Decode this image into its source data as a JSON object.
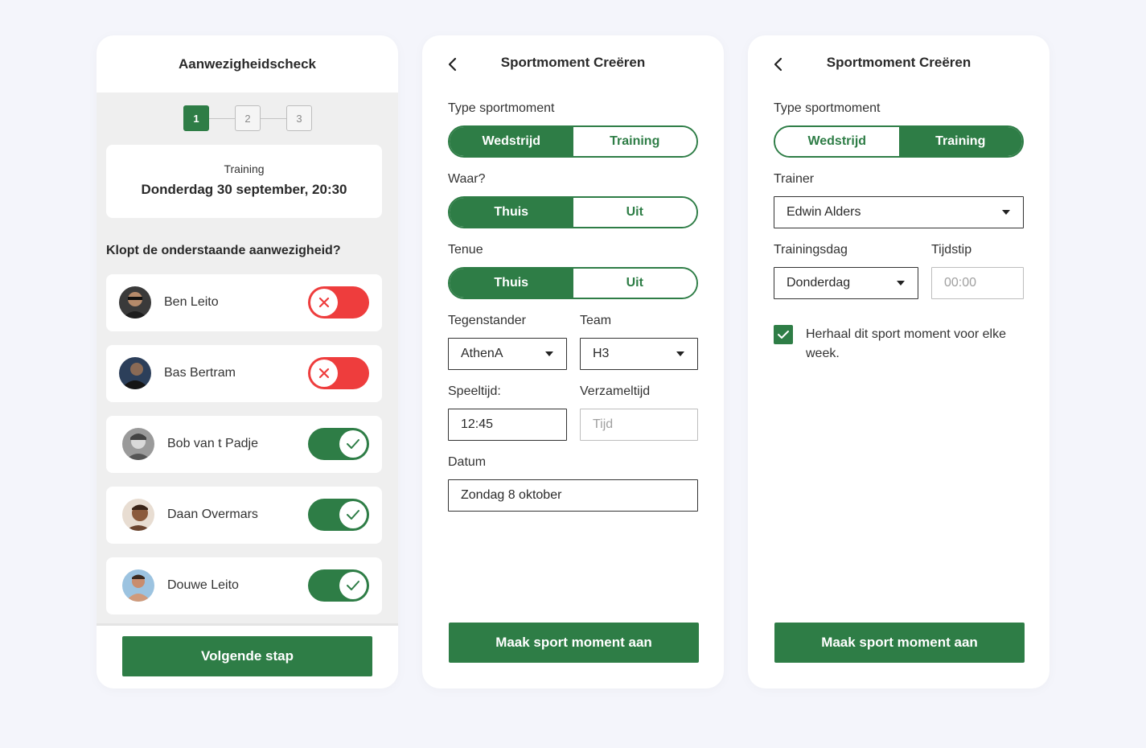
{
  "colors": {
    "accent": "#2e7d46",
    "danger": "#ee3d3d",
    "background": "#f4f5fb"
  },
  "attendance": {
    "title": "Aanwezigheidscheck",
    "steps": [
      "1",
      "2",
      "3"
    ],
    "active_step": 1,
    "session_type": "Training",
    "session_date": "Donderdag 30 september, 20:30",
    "question": "Klopt de onderstaande aanwezigheid?",
    "people": [
      {
        "name": "Ben Leito",
        "present": false
      },
      {
        "name": "Bas Bertram",
        "present": false
      },
      {
        "name": "Bob van t Padje",
        "present": true
      },
      {
        "name": "Daan Overmars",
        "present": true
      },
      {
        "name": "Douwe Leito",
        "present": true
      }
    ],
    "next_button": "Volgende stap"
  },
  "match_form": {
    "title": "Sportmoment Creëren",
    "type_label": "Type sportmoment",
    "type_options": [
      "Wedstrijd",
      "Training"
    ],
    "type_selected": "Wedstrijd",
    "where_label": "Waar?",
    "where_options": [
      "Thuis",
      "Uit"
    ],
    "where_selected": "Thuis",
    "outfit_label": "Tenue",
    "outfit_options": [
      "Thuis",
      "Uit"
    ],
    "outfit_selected": "Thuis",
    "opponent_label": "Tegenstander",
    "opponent_value": "AthenA",
    "team_label": "Team",
    "team_value": "H3",
    "playtime_label": "Speeltijd:",
    "playtime_value": "12:45",
    "gathertime_label": "Verzameltijd",
    "gathertime_placeholder": "Tijd",
    "date_label": "Datum",
    "date_value": "Zondag 8 oktober",
    "submit_button": "Maak sport moment aan"
  },
  "training_form": {
    "title": "Sportmoment Creëren",
    "type_label": "Type sportmoment",
    "type_options": [
      "Wedstrijd",
      "Training"
    ],
    "type_selected": "Training",
    "trainer_label": "Trainer",
    "trainer_value": "Edwin Alders",
    "day_label": "Trainingsdag",
    "day_value": "Donderdag",
    "time_label": "Tijdstip",
    "time_placeholder": "00:00",
    "repeat_checked": true,
    "repeat_text": "Herhaal dit sport moment voor elke week.",
    "submit_button": "Maak sport moment aan"
  }
}
